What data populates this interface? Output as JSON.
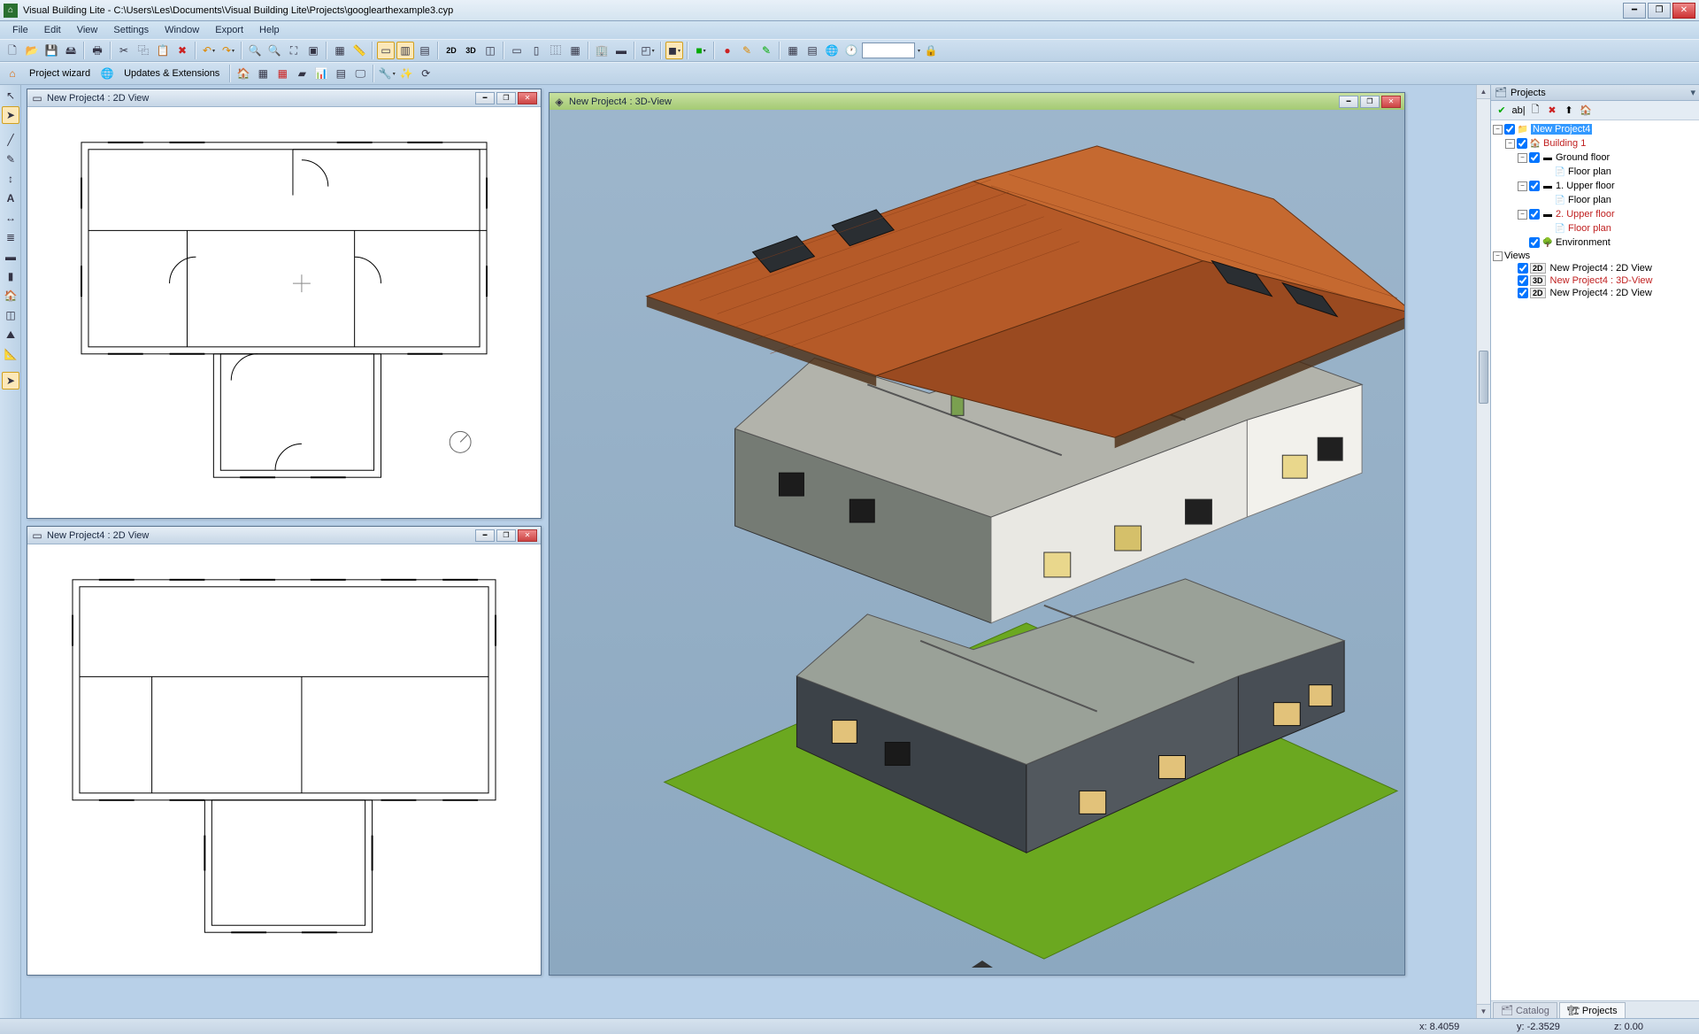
{
  "titlebar": {
    "text": "Visual Building Lite - C:\\Users\\Les\\Documents\\Visual Building Lite\\Projects\\googlearthexample3.cyp"
  },
  "menu": [
    "File",
    "Edit",
    "View",
    "Settings",
    "Window",
    "Export",
    "Help"
  ],
  "toolbar2": {
    "project_wizard": "Project wizard",
    "updates": "Updates & Extensions"
  },
  "windows": {
    "plan2d_a": "New Project4 : 2D View",
    "plan2d_b": "New Project4 : 2D View",
    "view3d": "New Project4 : 3D-View"
  },
  "projects_panel": {
    "title": "Projects",
    "root": "New Project4",
    "building": "Building 1",
    "ground_floor": "Ground floor",
    "floor_plan": "Floor plan",
    "upper_floor_1": "1. Upper floor",
    "upper_floor_2": "2. Upper floor",
    "environment": "Environment",
    "views": "Views",
    "badge2d": "2D",
    "badge3d": "3D",
    "view_a": "New Project4 : 2D View",
    "view_b": "New Project4 : 3D-View",
    "view_c": "New Project4 : 2D View",
    "tab_catalog": "Catalog",
    "tab_projects": "Projects"
  },
  "status": {
    "x": "x: 8.4059",
    "y": "y: -2.3529",
    "z": "z: 0.00"
  }
}
